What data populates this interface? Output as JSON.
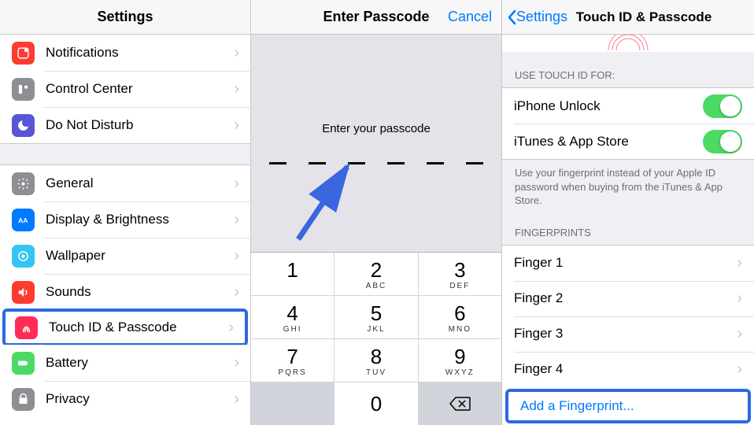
{
  "panel1": {
    "title": "Settings",
    "g1": [
      {
        "icon": "notif",
        "label": "Notifications"
      },
      {
        "icon": "cc",
        "label": "Control Center"
      },
      {
        "icon": "dnd",
        "label": "Do Not Disturb"
      }
    ],
    "g2": [
      {
        "icon": "gen",
        "label": "General"
      },
      {
        "icon": "disp",
        "label": "Display & Brightness"
      },
      {
        "icon": "wall",
        "label": "Wallpaper"
      },
      {
        "icon": "sound",
        "label": "Sounds"
      },
      {
        "icon": "touch",
        "label": "Touch ID & Passcode",
        "highlight": true
      },
      {
        "icon": "batt",
        "label": "Battery"
      },
      {
        "icon": "priv",
        "label": "Privacy"
      }
    ]
  },
  "panel2": {
    "title": "Enter Passcode",
    "cancel": "Cancel",
    "prompt": "Enter your passcode",
    "dashes": 6,
    "keys": [
      {
        "n": "1",
        "s": ""
      },
      {
        "n": "2",
        "s": "ABC"
      },
      {
        "n": "3",
        "s": "DEF"
      },
      {
        "n": "4",
        "s": "GHI"
      },
      {
        "n": "5",
        "s": "JKL"
      },
      {
        "n": "6",
        "s": "MNO"
      },
      {
        "n": "7",
        "s": "PQRS"
      },
      {
        "n": "8",
        "s": "TUV"
      },
      {
        "n": "9",
        "s": "WXYZ"
      }
    ],
    "zero": "0"
  },
  "panel3": {
    "back": "Settings",
    "title": "Touch ID & Passcode",
    "sect1_hdr": "USE TOUCH ID FOR:",
    "toggles": [
      {
        "label": "iPhone Unlock",
        "on": true
      },
      {
        "label": "iTunes & App Store",
        "on": true
      }
    ],
    "sect1_foot": "Use your fingerprint instead of your Apple ID password when buying from the iTunes & App Store.",
    "sect2_hdr": "FINGERPRINTS",
    "fingers": [
      "Finger 1",
      "Finger 2",
      "Finger 3",
      "Finger 4"
    ],
    "add": "Add a Fingerprint..."
  }
}
